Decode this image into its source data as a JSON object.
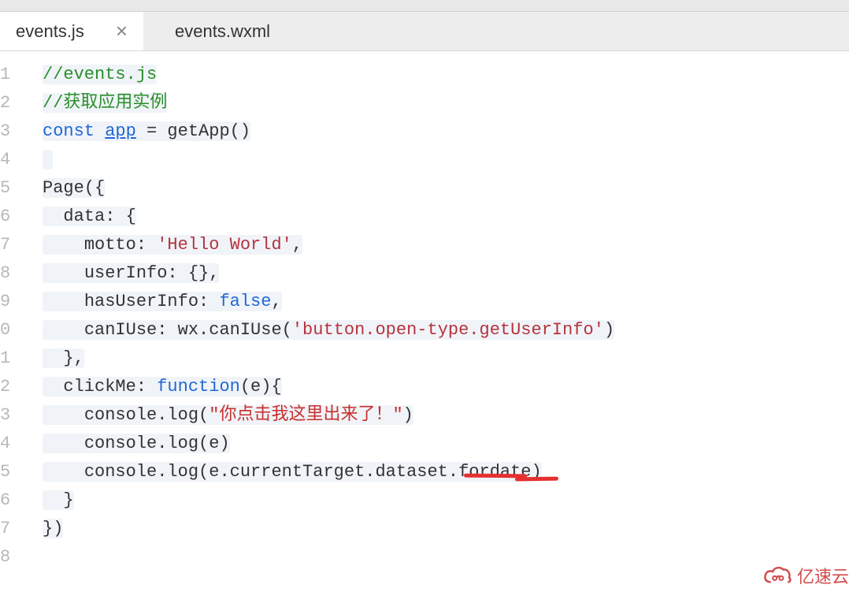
{
  "tabs": [
    {
      "label": "events.js",
      "active": true
    },
    {
      "label": "events.wxml",
      "active": false
    }
  ],
  "gutter": [
    "1",
    "2",
    "3",
    "4",
    "5",
    "6",
    "7",
    "8",
    "9",
    "0",
    "1",
    "2",
    "3",
    "4",
    "5",
    "6",
    "7",
    "8"
  ],
  "code": {
    "l1": {
      "comment": "//events.js"
    },
    "l2": {
      "comment": "//获取应用实例"
    },
    "l3": {
      "kw": "const",
      "var": "app",
      "rest": " = getApp()"
    },
    "l4": "",
    "l5": {
      "text": "Page({"
    },
    "l6": {
      "indent": "  ",
      "text": "data: {"
    },
    "l7": {
      "indent": "    ",
      "key": "motto: ",
      "str": "'Hello World'",
      "tail": ","
    },
    "l8": {
      "indent": "    ",
      "text": "userInfo: {},"
    },
    "l9": {
      "indent": "    ",
      "key": "hasUserInfo: ",
      "bool": "false",
      "tail": ","
    },
    "l10": {
      "indent": "    ",
      "key": "canIUse: wx.canIUse(",
      "str": "'button.open-type.getUserInfo'",
      "tail": ")"
    },
    "l11": {
      "indent": "  ",
      "text": "},"
    },
    "l12": {
      "indent": "  ",
      "pre": "clickMe: ",
      "kw": "function",
      "post": "(e){"
    },
    "l13": {
      "indent": "    ",
      "pre": "console.log(",
      "str": "\"你点击我这里出来了！\"",
      "post": ")"
    },
    "l14": {
      "indent": "    ",
      "text": "console.log(e)"
    },
    "l15": {
      "indent": "    ",
      "text": "console.log(e.currentTarget.dataset.fordate)"
    },
    "l16": {
      "indent": "  ",
      "text": "}"
    },
    "l17": {
      "text": "})"
    }
  },
  "watermark": {
    "text": "亿速云"
  }
}
